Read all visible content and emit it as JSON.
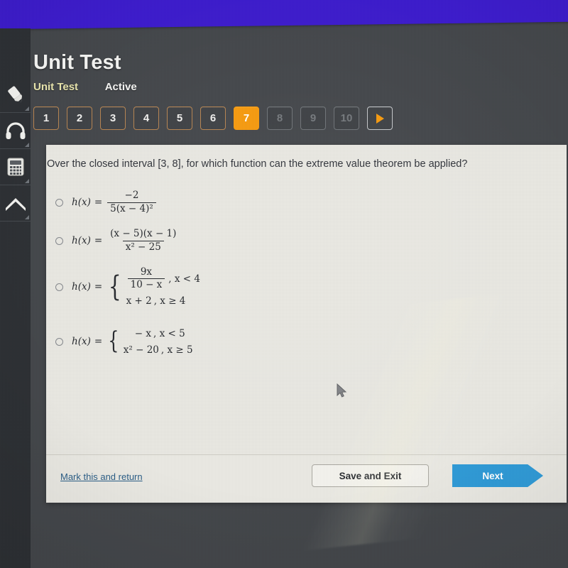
{
  "browser": {
    "top_bar_color": "#3c1bcb"
  },
  "sidebar": {
    "tools": [
      {
        "name": "highlighter-icon",
        "label": "Highlighter"
      },
      {
        "name": "headphones-icon",
        "label": "Audio"
      },
      {
        "name": "calculator-icon",
        "label": "Calculator"
      },
      {
        "name": "arrow-up-icon",
        "label": "Scroll to top"
      }
    ]
  },
  "header": {
    "title": "Unit Test",
    "breadcrumb_unit": "Unit Test",
    "breadcrumb_status": "Active",
    "breadcrumb_unit_color": "#e8e4ac"
  },
  "pagination": {
    "current": "7",
    "accent_color": "#f5990d",
    "items": [
      {
        "label": "1",
        "state": "available"
      },
      {
        "label": "2",
        "state": "available"
      },
      {
        "label": "3",
        "state": "available"
      },
      {
        "label": "4",
        "state": "available"
      },
      {
        "label": "5",
        "state": "available"
      },
      {
        "label": "6",
        "state": "available"
      },
      {
        "label": "7",
        "state": "current"
      },
      {
        "label": "8",
        "state": "disabled"
      },
      {
        "label": "9",
        "state": "disabled"
      },
      {
        "label": "10",
        "state": "disabled"
      }
    ],
    "next_arrow_icon": "triangle-right-icon"
  },
  "question": {
    "text": "Over the closed interval [3, 8], for which function can the extreme value theorem be applied?",
    "selected_choice": null,
    "choices": [
      {
        "id": "a",
        "kind": "fraction",
        "lhs": "h(x)",
        "equals": "=",
        "numerator": "−2",
        "denominator": "5(x − 4)²",
        "plain": "h(x) = -2 / (5(x - 4)^2)"
      },
      {
        "id": "b",
        "kind": "fraction",
        "lhs": "h(x)",
        "equals": "=",
        "numerator": "(x − 5)(x − 1)",
        "denominator": "x² − 25",
        "plain": "h(x) = (x - 5)(x - 1) / (x^2 - 25)"
      },
      {
        "id": "c",
        "kind": "piecewise",
        "lhs": "h(x)",
        "equals": "=",
        "row1_expr_num": "9x",
        "row1_expr_den": "10 − x",
        "row1_cond": ", x < 4",
        "row2_expr": "x + 2",
        "row2_cond": ", x ≥ 4",
        "plain": "h(x) = { 9x/(10 - x), x < 4 ; x + 2, x >= 4 }"
      },
      {
        "id": "d",
        "kind": "piecewise",
        "lhs": "h(x)",
        "equals": "=",
        "row1_expr": "− x",
        "row1_cond": ", x < 5",
        "row2_expr": "x² − 20",
        "row2_cond": ", x ≥ 5",
        "plain": "h(x) = { -x, x < 5 ; x^2 - 20, x >= 5 }"
      }
    ]
  },
  "footer": {
    "mark_link": "Mark this and return",
    "save_exit": "Save and Exit",
    "next": "Next",
    "next_color": "#2f9ad6"
  }
}
